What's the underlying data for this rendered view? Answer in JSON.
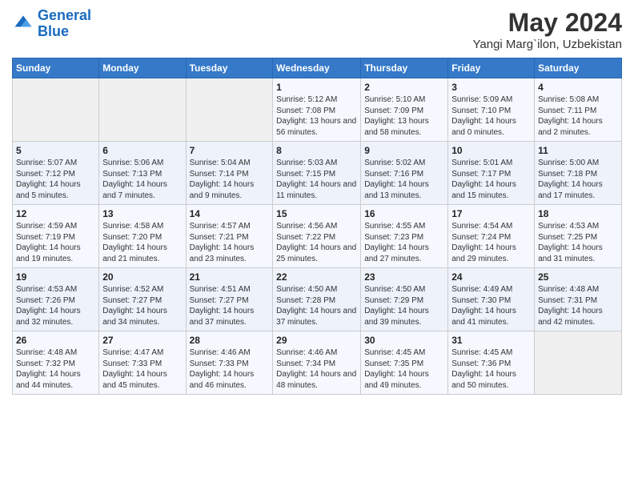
{
  "header": {
    "logo_line1": "General",
    "logo_line2": "Blue",
    "main_title": "May 2024",
    "subtitle": "Yangi Marg`ilon, Uzbekistan"
  },
  "weekdays": [
    "Sunday",
    "Monday",
    "Tuesday",
    "Wednesday",
    "Thursday",
    "Friday",
    "Saturday"
  ],
  "weeks": [
    [
      {
        "day": "",
        "info": ""
      },
      {
        "day": "",
        "info": ""
      },
      {
        "day": "",
        "info": ""
      },
      {
        "day": "1",
        "info": "Sunrise: 5:12 AM\nSunset: 7:08 PM\nDaylight: 13 hours and 56 minutes."
      },
      {
        "day": "2",
        "info": "Sunrise: 5:10 AM\nSunset: 7:09 PM\nDaylight: 13 hours and 58 minutes."
      },
      {
        "day": "3",
        "info": "Sunrise: 5:09 AM\nSunset: 7:10 PM\nDaylight: 14 hours and 0 minutes."
      },
      {
        "day": "4",
        "info": "Sunrise: 5:08 AM\nSunset: 7:11 PM\nDaylight: 14 hours and 2 minutes."
      }
    ],
    [
      {
        "day": "5",
        "info": "Sunrise: 5:07 AM\nSunset: 7:12 PM\nDaylight: 14 hours and 5 minutes."
      },
      {
        "day": "6",
        "info": "Sunrise: 5:06 AM\nSunset: 7:13 PM\nDaylight: 14 hours and 7 minutes."
      },
      {
        "day": "7",
        "info": "Sunrise: 5:04 AM\nSunset: 7:14 PM\nDaylight: 14 hours and 9 minutes."
      },
      {
        "day": "8",
        "info": "Sunrise: 5:03 AM\nSunset: 7:15 PM\nDaylight: 14 hours and 11 minutes."
      },
      {
        "day": "9",
        "info": "Sunrise: 5:02 AM\nSunset: 7:16 PM\nDaylight: 14 hours and 13 minutes."
      },
      {
        "day": "10",
        "info": "Sunrise: 5:01 AM\nSunset: 7:17 PM\nDaylight: 14 hours and 15 minutes."
      },
      {
        "day": "11",
        "info": "Sunrise: 5:00 AM\nSunset: 7:18 PM\nDaylight: 14 hours and 17 minutes."
      }
    ],
    [
      {
        "day": "12",
        "info": "Sunrise: 4:59 AM\nSunset: 7:19 PM\nDaylight: 14 hours and 19 minutes."
      },
      {
        "day": "13",
        "info": "Sunrise: 4:58 AM\nSunset: 7:20 PM\nDaylight: 14 hours and 21 minutes."
      },
      {
        "day": "14",
        "info": "Sunrise: 4:57 AM\nSunset: 7:21 PM\nDaylight: 14 hours and 23 minutes."
      },
      {
        "day": "15",
        "info": "Sunrise: 4:56 AM\nSunset: 7:22 PM\nDaylight: 14 hours and 25 minutes."
      },
      {
        "day": "16",
        "info": "Sunrise: 4:55 AM\nSunset: 7:23 PM\nDaylight: 14 hours and 27 minutes."
      },
      {
        "day": "17",
        "info": "Sunrise: 4:54 AM\nSunset: 7:24 PM\nDaylight: 14 hours and 29 minutes."
      },
      {
        "day": "18",
        "info": "Sunrise: 4:53 AM\nSunset: 7:25 PM\nDaylight: 14 hours and 31 minutes."
      }
    ],
    [
      {
        "day": "19",
        "info": "Sunrise: 4:53 AM\nSunset: 7:26 PM\nDaylight: 14 hours and 32 minutes."
      },
      {
        "day": "20",
        "info": "Sunrise: 4:52 AM\nSunset: 7:27 PM\nDaylight: 14 hours and 34 minutes."
      },
      {
        "day": "21",
        "info": "Sunrise: 4:51 AM\nSunset: 7:27 PM\nDaylight: 14 hours and 37 minutes."
      },
      {
        "day": "22",
        "info": "Sunrise: 4:50 AM\nSunset: 7:28 PM\nDaylight: 14 hours and 37 minutes."
      },
      {
        "day": "23",
        "info": "Sunrise: 4:50 AM\nSunset: 7:29 PM\nDaylight: 14 hours and 39 minutes."
      },
      {
        "day": "24",
        "info": "Sunrise: 4:49 AM\nSunset: 7:30 PM\nDaylight: 14 hours and 41 minutes."
      },
      {
        "day": "25",
        "info": "Sunrise: 4:48 AM\nSunset: 7:31 PM\nDaylight: 14 hours and 42 minutes."
      }
    ],
    [
      {
        "day": "26",
        "info": "Sunrise: 4:48 AM\nSunset: 7:32 PM\nDaylight: 14 hours and 44 minutes."
      },
      {
        "day": "27",
        "info": "Sunrise: 4:47 AM\nSunset: 7:33 PM\nDaylight: 14 hours and 45 minutes."
      },
      {
        "day": "28",
        "info": "Sunrise: 4:46 AM\nSunset: 7:33 PM\nDaylight: 14 hours and 46 minutes."
      },
      {
        "day": "29",
        "info": "Sunrise: 4:46 AM\nSunset: 7:34 PM\nDaylight: 14 hours and 48 minutes."
      },
      {
        "day": "30",
        "info": "Sunrise: 4:45 AM\nSunset: 7:35 PM\nDaylight: 14 hours and 49 minutes."
      },
      {
        "day": "31",
        "info": "Sunrise: 4:45 AM\nSunset: 7:36 PM\nDaylight: 14 hours and 50 minutes."
      },
      {
        "day": "",
        "info": ""
      }
    ]
  ]
}
